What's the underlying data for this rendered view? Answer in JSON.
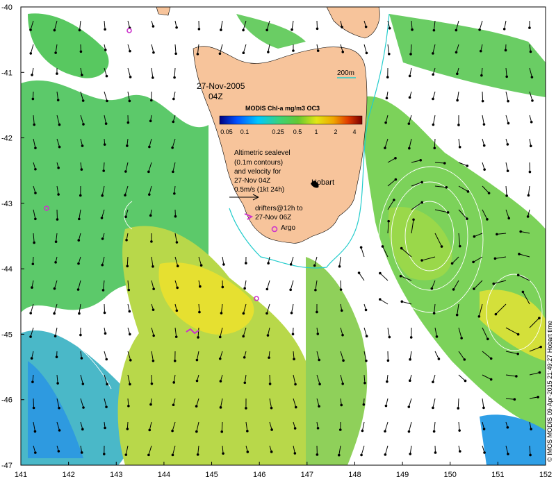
{
  "map": {
    "date_line1": "27-Nov-2005",
    "date_line2": "04Z",
    "scale_label": "200m",
    "colorbar": {
      "title": "MODIS Chl-a mg/m3 OC3",
      "ticks": [
        "0.05",
        "0.1",
        "0.25",
        "0.5",
        "1",
        "2",
        "4"
      ]
    },
    "altimetry_note": [
      "Altimetric sealevel",
      "(0.1m contours)",
      "and velocity for",
      "27-Nov 04Z",
      "0.5m/s (1kt 24h)"
    ],
    "city": "Hobart",
    "drifters_note": [
      "drifters@12h to",
      "27-Nov 06Z"
    ],
    "argo_label": "Argo",
    "credit": "© IMOS MODIS 09-Apr-2015 21:49:27 Hobart time",
    "lon_ticks": [
      "141",
      "142",
      "143",
      "144",
      "145",
      "146",
      "147",
      "148",
      "149",
      "150",
      "151",
      "152"
    ],
    "lat_ticks": [
      "-40",
      "-41",
      "-42",
      "-43",
      "-44",
      "-45",
      "-46",
      "-47"
    ],
    "colors": {
      "land": "#f7c49b",
      "argo": "#cc33cc",
      "contour_200m": "#22cccc",
      "colormap": [
        "#00007f",
        "#0050ff",
        "#00c8ff",
        "#3cd278",
        "#64c832",
        "#e1e614",
        "#f0a500",
        "#e13c00",
        "#780000"
      ]
    }
  }
}
